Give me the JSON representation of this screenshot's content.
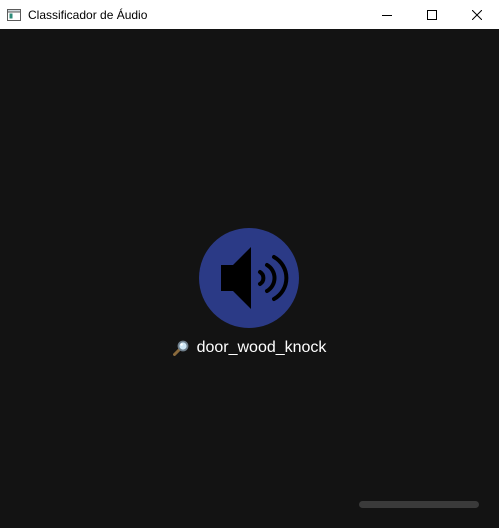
{
  "window": {
    "title": "Classificador de Áudio"
  },
  "icons": {
    "app": "app-window-icon",
    "minimize": "minimize-icon",
    "maximize": "maximize-icon",
    "close": "close-icon",
    "speaker": "speaker-icon",
    "search": "magnifier-icon"
  },
  "result": {
    "label": "door_wood_knock"
  },
  "colors": {
    "background": "#131313",
    "speaker_circle": "#2b3a86",
    "text": "#ffffff"
  }
}
